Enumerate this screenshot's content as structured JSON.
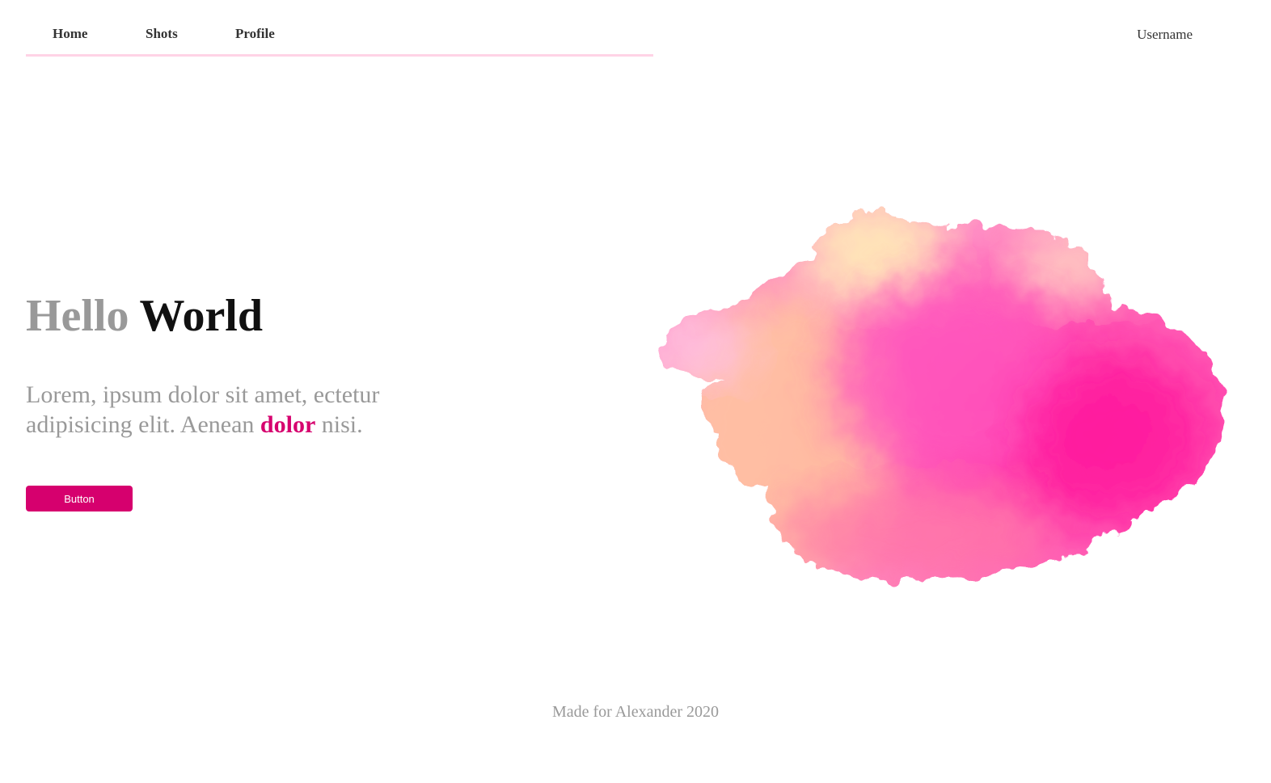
{
  "nav": {
    "items": [
      {
        "label": "Home"
      },
      {
        "label": "Shots"
      },
      {
        "label": "Profile"
      }
    ],
    "username": "Username",
    "underline_color": "#ffd3e6"
  },
  "hero": {
    "title_light": "Hello",
    "title_dark": "World",
    "text_before": "Lorem, ipsum dolor sit amet, ectetur adipisicing elit. Aenean",
    "text_accent": "dolor",
    "text_after": "nisi.",
    "button_label": "Button"
  },
  "footer": {
    "text": "Made for Alexander 2020"
  },
  "colors": {
    "accent": "#d6006e",
    "muted": "#999999",
    "text": "#333333",
    "splash_primary": "#ff4fb3",
    "splash_secondary": "#ffd6a8"
  },
  "icons": {
    "splash": "watercolor-splash-icon"
  }
}
